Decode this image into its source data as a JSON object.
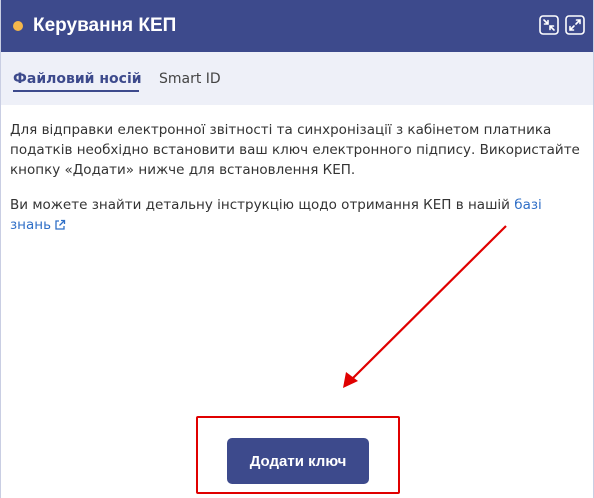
{
  "header": {
    "title": "Керування КЕП",
    "status_color": "#f5b74a",
    "buttons": [
      {
        "icon": "collapse-icon"
      },
      {
        "icon": "expand-icon"
      }
    ]
  },
  "tabs": [
    {
      "label": "Файловий носій",
      "active": true
    },
    {
      "label": "Smart ID",
      "active": false
    }
  ],
  "content": {
    "paragraph1": "Для відправки електронної звітності та синхронізації з кабінетом платника податків необхідно встановити ваш ключ електронного підпису. Використайте кнопку «Додати» нижче для встановлення КЕП.",
    "paragraph2_text": "Ви можете знайти детальну інструкцію щодо отримання КЕП в нашій ",
    "paragraph2_link": "базі знань",
    "link_icon": "external-link-icon"
  },
  "annotation": {
    "arrow_color": "#e00000",
    "highlight_color": "#e00000"
  },
  "primary_button": {
    "label": "Додати ключ",
    "color": "#3d4a8c"
  }
}
